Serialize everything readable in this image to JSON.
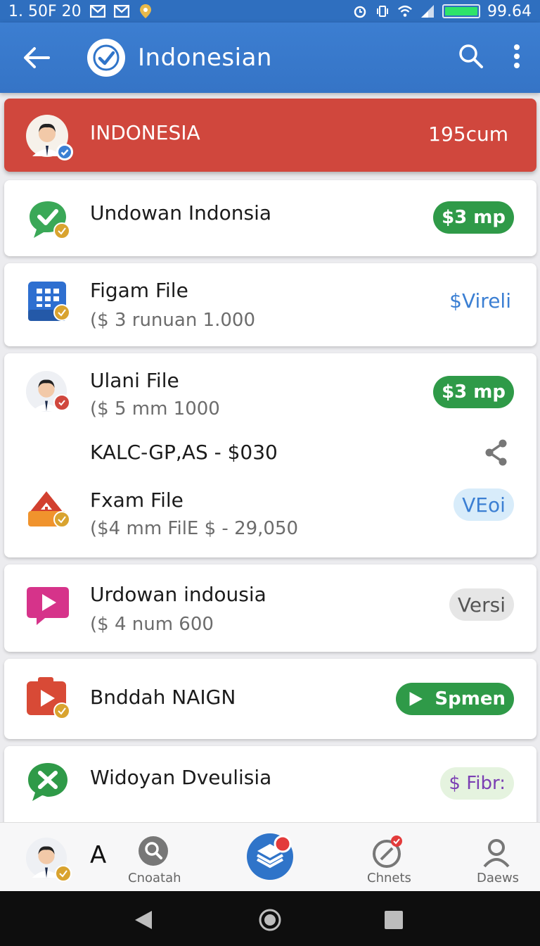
{
  "status_bar": {
    "time": "1. 50F 20",
    "battery_level": "99.64",
    "battery_fraction": 1.0
  },
  "app_bar": {
    "title": "Indonesian"
  },
  "banner": {
    "title": "INDONESIA",
    "value": "195cum",
    "color": "#d0473d"
  },
  "items": [
    {
      "title": "Undowan Indonsia",
      "subtitle": "",
      "badge": "$3 mp",
      "badge_style": "green"
    },
    {
      "title": "Figam File",
      "subtitle": "($ 3 runuan 1.000",
      "badge": "$Vireli",
      "badge_style": "link"
    },
    {
      "title": "Ulani File",
      "subtitle": "($ 5 mm 1000",
      "badge": "$3 mp",
      "badge_style": "green"
    },
    {
      "title": "KALC-GP,AS - $030",
      "subtitle": "",
      "badge": "",
      "badge_style": "share"
    },
    {
      "title": "Fxam File",
      "subtitle": "($4 mm FilE  $ - 29,050",
      "badge": "VEoi",
      "badge_style": "lightblue"
    },
    {
      "title": "Urdowan indousia",
      "subtitle": "($ 4 num 600",
      "badge": "Versi",
      "badge_style": "gray"
    },
    {
      "title": "Bnddah NAIGN",
      "subtitle": "",
      "badge": "Spmen",
      "badge_style": "play"
    },
    {
      "title": "Widoyan Dveulisia",
      "subtitle": "",
      "badge": "$ Fibr:",
      "badge_style": "purple"
    }
  ],
  "bottom_nav": {
    "letter": "A",
    "items": [
      {
        "label": "Cnoatah",
        "icon": "search-icon"
      },
      {
        "label": "",
        "icon": "stack-icon"
      },
      {
        "label": "Chnets",
        "icon": "compass-icon"
      },
      {
        "label": "Daews",
        "icon": "person-icon"
      }
    ]
  },
  "colors": {
    "app_bar": "#3c7ed1",
    "green": "#2f9a48",
    "link_blue": "#3b7fd3",
    "purple": "#7b3fb3"
  }
}
